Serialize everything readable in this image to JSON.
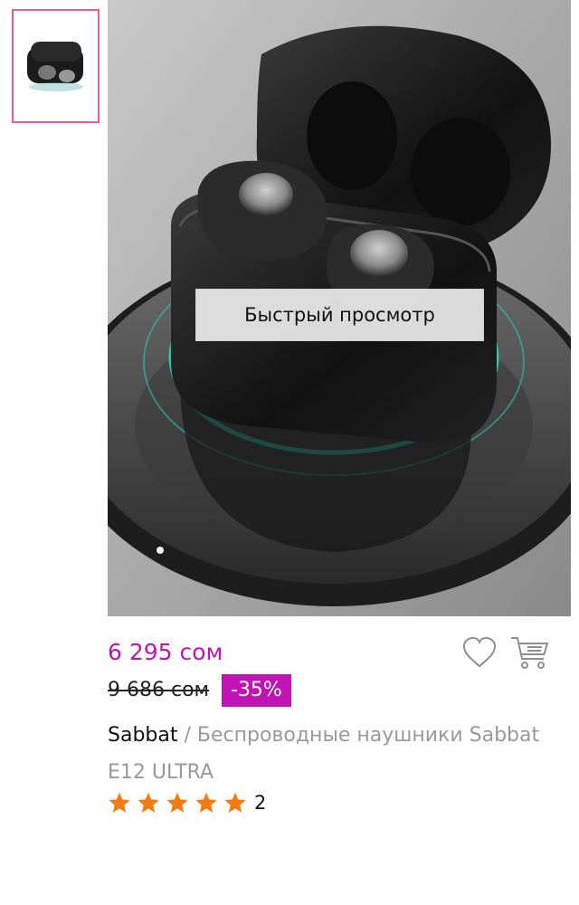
{
  "gallery": {
    "thumbnail_alt": "Sabbat E12 ULTRA thumbnail",
    "quick_view_label": "Быстрый просмотр"
  },
  "product": {
    "price": "6 295 сом",
    "old_price": "9 686 сом",
    "discount": "-35%",
    "brand": "Sabbat",
    "separator": " / ",
    "name": "Беспроводные наушники Sabbat E12 ULTRA",
    "rating_stars": 5,
    "rating_count": "2"
  },
  "actions": {
    "favorite_icon": "heart-icon",
    "cart_icon": "cart-icon"
  },
  "colors": {
    "accent": "#c014b5",
    "thumb_border": "#e85aa8",
    "star": "#f57a10",
    "muted_text": "#9a9a9a"
  }
}
